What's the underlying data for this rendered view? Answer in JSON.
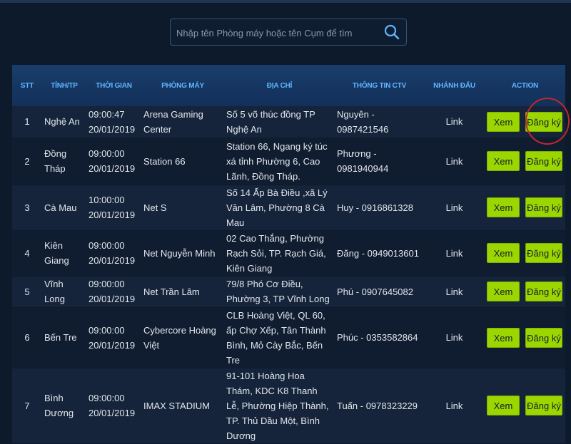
{
  "search": {
    "placeholder": "Nhập tên Phòng máy hoặc tên Cụm để tìm"
  },
  "table": {
    "headers": [
      "STT",
      "TỈNH/TP",
      "THỜI GIAN",
      "PHÒNG MÁY",
      "ĐỊA CHỈ",
      "THÔNG TIN CTV",
      "NHÁNH ĐẤU",
      "ACTION"
    ],
    "rows": [
      {
        "stt": "1",
        "province": "Nghệ An",
        "time": "09:00:47",
        "date": "20/01/2019",
        "room": "Arena Gaming Center",
        "address": "Số 5 võ thúc đồng TP Nghệ An",
        "ctv": "Nguyên - 0987421546",
        "bracket": "Link",
        "view": "Xem",
        "register": "Đăng ký"
      },
      {
        "stt": "2",
        "province": "Đồng Tháp",
        "time": "09:00:00",
        "date": "20/01/2019",
        "room": "Station 66",
        "address": "Station 66, Ngang ký túc xá tỉnh Phường 6, Cao Lãnh, Đồng Tháp.",
        "ctv": "Phương - 0981940944",
        "bracket": "Link",
        "view": "Xem",
        "register": "Đăng ký"
      },
      {
        "stt": "3",
        "province": "Cà Mau",
        "time": "10:00:00",
        "date": "20/01/2019",
        "room": "Net S",
        "address": "Số 14 Ấp Bà Điều ,xã Lý Văn Lâm, Phường 8 Cà Mau",
        "ctv": "Huy - 0916861328",
        "bracket": "Link",
        "view": "Xem",
        "register": "Đăng ký"
      },
      {
        "stt": "4",
        "province": "Kiên Giang",
        "time": "09:00:00",
        "date": "20/01/2019",
        "room": "Net Nguyễn Minh",
        "address": "02 Cao Thắng, Phường Rạch Sỏi, TP. Rạch Giá, Kiên Giang",
        "ctv": "Đăng - 0949013601",
        "bracket": "Link",
        "view": "Xem",
        "register": "Đăng ký"
      },
      {
        "stt": "5",
        "province": "Vĩnh Long",
        "time": "09:00:00",
        "date": "20/01/2019",
        "room": "Net Trần Lâm",
        "address": "79/8 Phó Cơ Điều, Phường 3, TP Vĩnh Long",
        "ctv": "Phú - 0907645082",
        "bracket": "Link",
        "view": "Xem",
        "register": "Đăng ký"
      },
      {
        "stt": "6",
        "province": "Bến Tre",
        "time": "09:00:00",
        "date": "20/01/2019",
        "room": "Cybercore Hoàng Việt",
        "address": "CLB Hoàng Việt, QL 60, ấp Chợ Xếp, Tân Thành Bình, Mỏ Cày Bắc, Bến Tre",
        "ctv": "Phúc - 0353582864",
        "bracket": "Link",
        "view": "Xem",
        "register": "Đăng ký"
      },
      {
        "stt": "7",
        "province": "Bình Dương",
        "time": "09:00:00",
        "date": "20/01/2019",
        "room": "IMAX STADIUM",
        "address": "91-101 Hoàng Hoa Thám, KDC K8 Thanh Lễ, Phường Hiệp Thành, TP. Thủ Dầu Một, Bình Dương",
        "ctv": "Tuấn - 0978323229",
        "bracket": "Link",
        "view": "Xem",
        "register": "Đăng ký"
      }
    ]
  },
  "accent_colors": {
    "header_bg": "#12305a",
    "header_text": "#5fb6ff",
    "button": "#9bd600",
    "highlight_circle": "#c0282d"
  }
}
